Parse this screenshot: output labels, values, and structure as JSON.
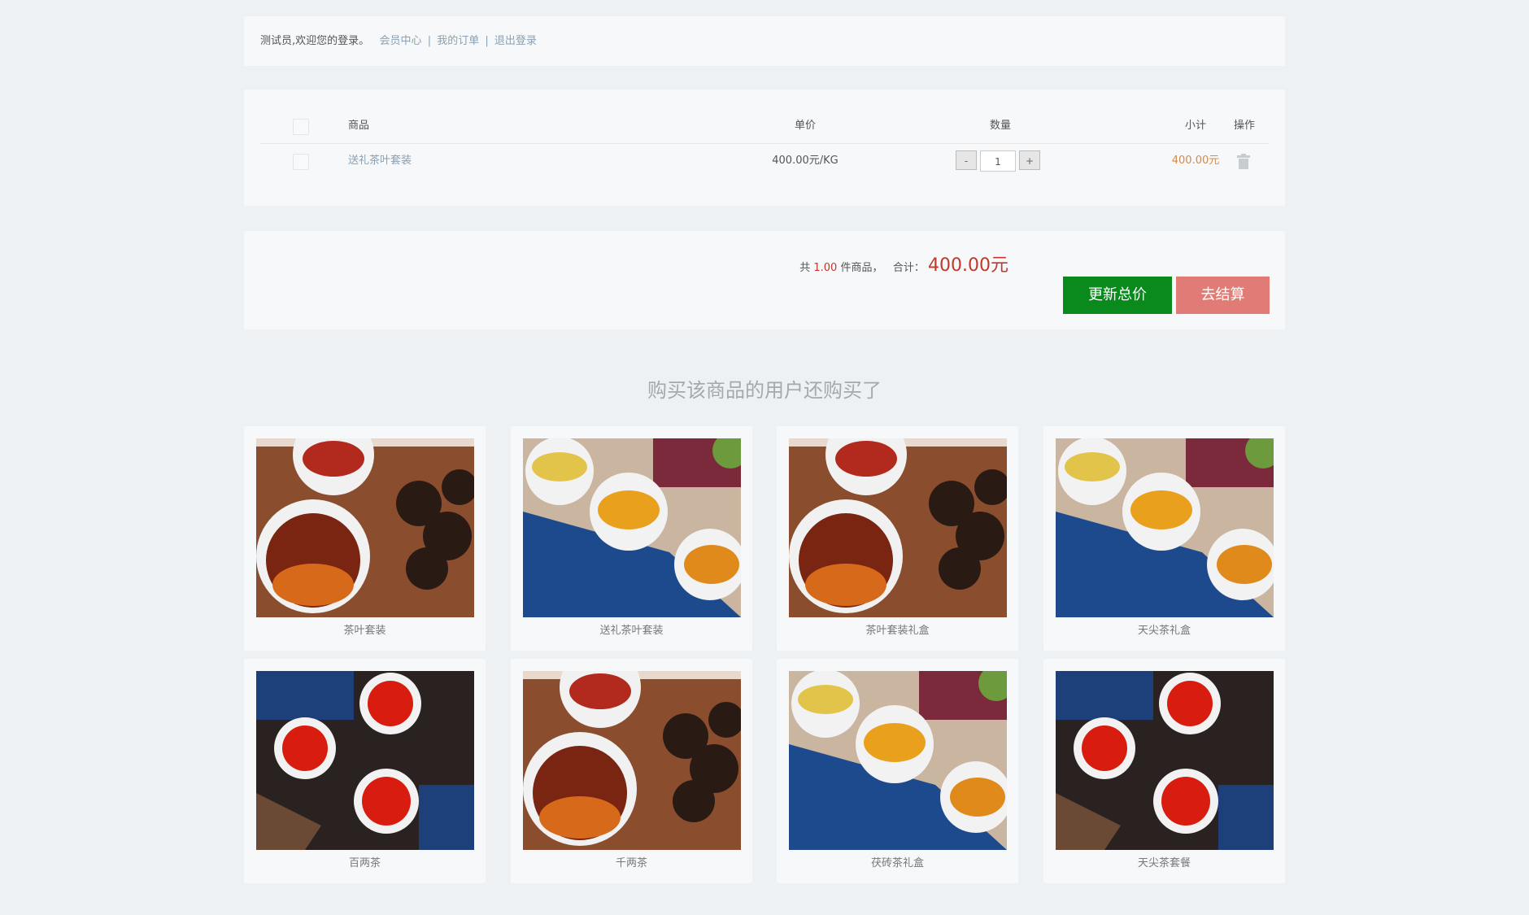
{
  "topbar": {
    "welcome": "测试员,欢迎您的登录。",
    "member_center": "会员中心",
    "divider": "|",
    "my_orders": "我的订单",
    "logout": "退出登录"
  },
  "cart": {
    "headers": {
      "product": "商品",
      "unit_price": "单价",
      "quantity": "数量",
      "subtotal": "小计",
      "action": "操作"
    },
    "items": [
      {
        "name": "送礼茶叶套装",
        "unit_price": "400.00元/KG",
        "quantity": "1",
        "subtotal": "400.00元"
      }
    ],
    "minus_label": "-",
    "plus_label": "+",
    "trash_icon": "trash-icon"
  },
  "summary": {
    "prefix": "共",
    "count": "1.00",
    "count_suffix": "件商品，",
    "total_label": "合计：",
    "total_value": "400.00元",
    "update_button": "更新总价",
    "checkout_button": "去结算"
  },
  "recommendations": {
    "title": "购买该商品的用户还购买了",
    "items": [
      {
        "name": "茶叶套装",
        "image": "tea-dark"
      },
      {
        "name": "送礼茶叶套装",
        "image": "tea-yellow"
      },
      {
        "name": "茶叶套装礼盒",
        "image": "tea-dark"
      },
      {
        "name": "天尖茶礼盒",
        "image": "tea-yellow"
      },
      {
        "name": "百两茶",
        "image": "tea-red"
      },
      {
        "name": "千两茶",
        "image": "tea-dark"
      },
      {
        "name": "茯砖茶礼盒",
        "image": "tea-yellow"
      },
      {
        "name": "天尖茶套餐",
        "image": "tea-red"
      }
    ]
  },
  "colors": {
    "background": "#eef1f4",
    "panel": "#f6f8f9",
    "update_button": "#0a8a1c",
    "checkout_button": "#e07b76",
    "price_red": "#c0392b",
    "subtotal_orange": "#d28b4b",
    "link_blue": "#8aa0b4"
  }
}
